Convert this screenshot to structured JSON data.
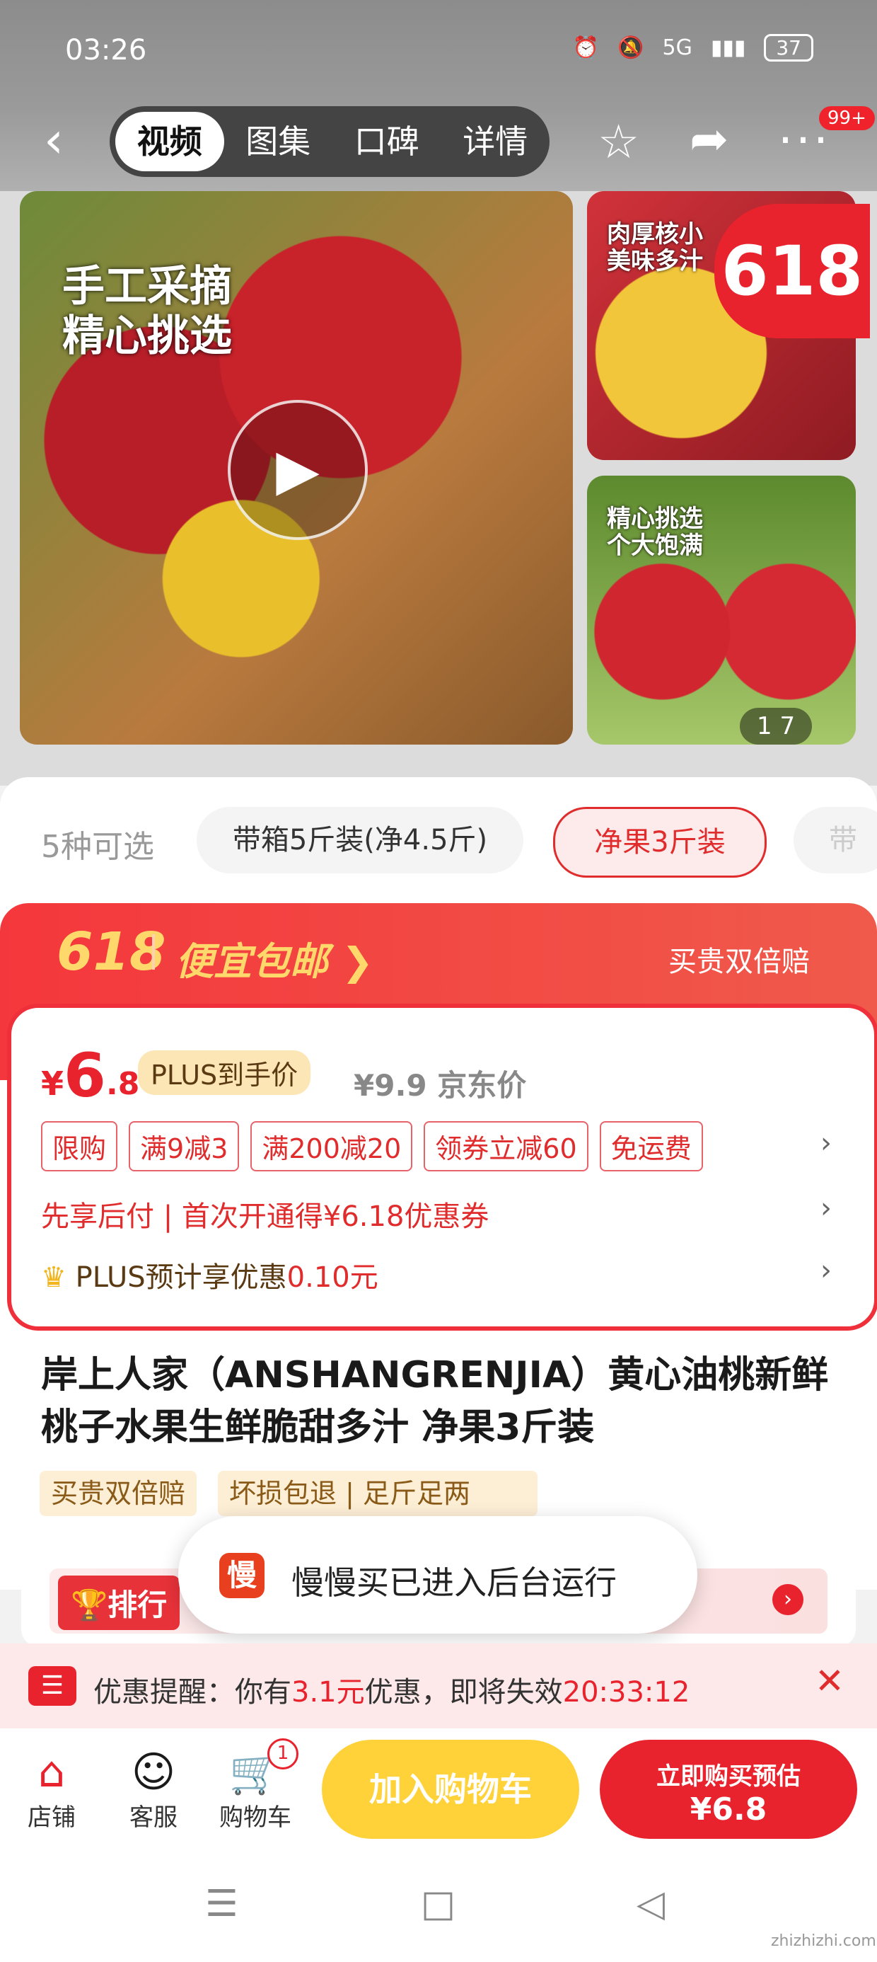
{
  "status": {
    "time": "03:26",
    "signal": "5G",
    "battery": "37"
  },
  "nav": {
    "tabs": [
      "视频",
      "图集",
      "口碑",
      "详情"
    ],
    "more_badge": "99+"
  },
  "media": {
    "main_caption_1": "手工采摘",
    "main_caption_2": "精心挑选",
    "side1_caption_1": "肉厚核小",
    "side1_caption_2": "美味多汁",
    "side2_caption_1": "精心挑选",
    "side2_caption_2": "个大饱满",
    "badge_618": "618",
    "pager": "1 7"
  },
  "variants": {
    "label": "5种可选",
    "options": [
      "带箱5斤装(净4.5斤)",
      "净果3斤装",
      "带"
    ]
  },
  "promo": {
    "event": "618",
    "free_shipping": "便宜包邮",
    "double_refund": "买贵双倍赔",
    "currency": "¥",
    "price_int": "6",
    "price_dec": ".8",
    "plus_label": "PLUS到手价",
    "jd_price": "¥9.9 京东价",
    "tags": [
      "限购",
      "满9减3",
      "满200减20",
      "领券立减60",
      "免运费"
    ],
    "credit_line": "先享后付 | 首次开通得¥6.18优惠券",
    "plus_line_a": "PLUS预计享优惠",
    "plus_line_b": "0.10元"
  },
  "product": {
    "title": "岸上人家（ANSHANGRENJIA）黄心油桃新鲜桃子水果生鲜脆甜多汁 净果3斤装",
    "tags": [
      "买贵双倍赔",
      "坏损包退",
      "足斤足两"
    ]
  },
  "rank": {
    "label": "排行"
  },
  "toast": {
    "icon_text": "慢",
    "text": "慢慢买已进入后台运行"
  },
  "reminder": {
    "a": "优惠提醒：你有",
    "amount": "3.1元",
    "b": "优惠，即将失效",
    "countdown": "20:33:12"
  },
  "bottom": {
    "shop": "店铺",
    "service": "客服",
    "cart": "购物车",
    "cart_count": "1",
    "add_cart": "加入购物车",
    "buy_now": "立即购买预估",
    "buy_price": "¥6.8"
  },
  "watermark": "zhizhizhi.com"
}
